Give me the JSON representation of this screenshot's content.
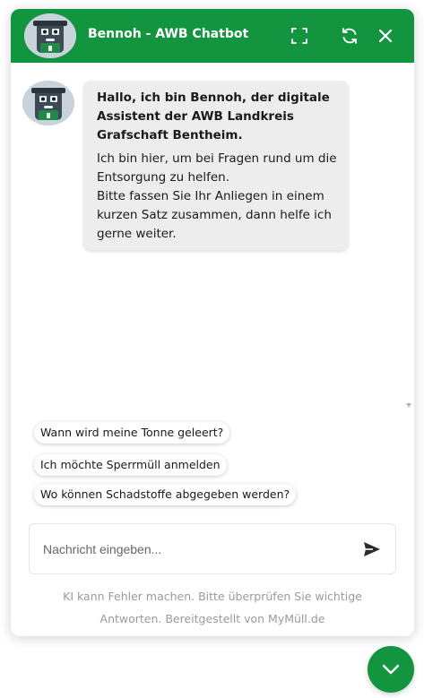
{
  "header": {
    "title": "Bennoh - AWB Chatbot"
  },
  "message": {
    "intro": "Hallo, ich bin Bennoh, der digitale Assistent der AWB Landkreis Grafschaft Bentheim.",
    "body_line1": "Ich bin hier, um bei Fragen rund um die Entsorgung zu helfen.",
    "body_line2": "Bitte fassen Sie Ihr Anliegen in einem kurzen Satz zusammen, dann helfe ich gerne weiter."
  },
  "suggestions": [
    "Wann wird meine Tonne geleert?",
    "Ich möchte Sperrmüll anmelden",
    "Wo können Schadstoffe abgegeben werden?"
  ],
  "input": {
    "placeholder": "Nachricht eingeben...",
    "value": ""
  },
  "disclaimer": "KI kann Fehler machen. Bitte überprüfen Sie wichtige Antworten. Bereitgestellt von MyMüll.de",
  "icons": {
    "header": [
      "robot-avatar",
      "expand-icon",
      "refresh-icon",
      "close-icon"
    ],
    "send": "send-icon",
    "toggle": "chevron-down-icon"
  },
  "colors": {
    "brand_green": "#13943e",
    "bubble_bg": "#ededed",
    "disclaimer_text": "#9a9a9a"
  }
}
